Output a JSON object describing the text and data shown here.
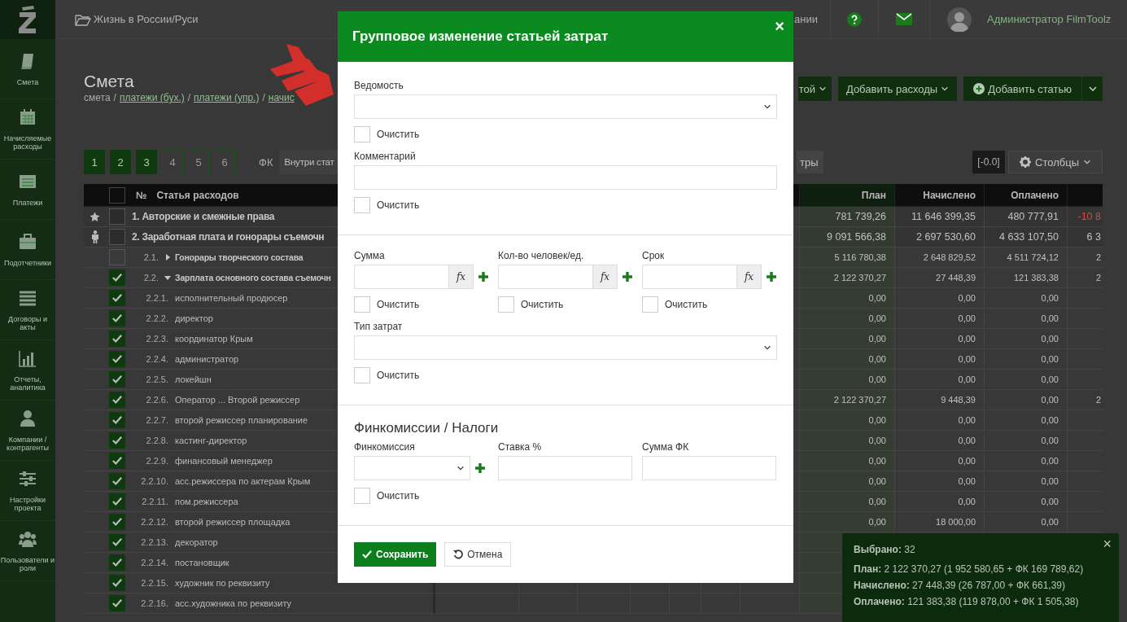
{
  "sidebar": {
    "items": [
      {
        "label": "Смета"
      },
      {
        "label": "Начисляемые расходы"
      },
      {
        "label": "Платежи"
      },
      {
        "label": "Подотчетники"
      },
      {
        "label": "Договоры и акты"
      },
      {
        "label": "Отчеты, аналитика"
      },
      {
        "label": "Компании / контрагенты"
      },
      {
        "label": "Настройки проекта"
      },
      {
        "label": "Пользователи и роли"
      }
    ]
  },
  "topbar": {
    "project": "Жизнь в России/Руси",
    "cut_link": "ании",
    "user": "Администратор FilmToolz"
  },
  "page": {
    "title": "Смета",
    "breadcrumbs": [
      {
        "label": "смета",
        "link": false
      },
      {
        "separator": "/",
        "label": "платежи (бух.)",
        "link": true
      },
      {
        "separator": "/",
        "label": "платежи (упр.)",
        "link": true
      },
      {
        "separator": "/",
        "label": "начис",
        "link": true
      }
    ],
    "actions": [
      {
        "label": "той",
        "kind": "dropdown"
      },
      {
        "label": "Добавить расходы",
        "kind": "dropdown"
      },
      {
        "label": "Добавить статью",
        "kind": "split"
      }
    ]
  },
  "levels": [
    {
      "label": "1",
      "selected": true
    },
    {
      "label": "2",
      "selected": true
    },
    {
      "label": "3",
      "selected": true
    },
    {
      "label": "4",
      "selected": false
    },
    {
      "label": "5",
      "selected": false
    },
    {
      "label": "6",
      "selected": false
    }
  ],
  "fk": {
    "label": "ФК",
    "value": "Внутри стат"
  },
  "filters_button": "тры",
  "rounding": "[-0.0]",
  "columns_button": "Столбцы",
  "table": {
    "header_checked": false,
    "columns": [
      "№",
      "Статья расходов",
      "План",
      "Начислено",
      "Оплачено"
    ],
    "rows": [
      {
        "kind": "group",
        "checked": false,
        "label": "1. Авторские и смежные права",
        "plan": "781 739,26",
        "accrued": "11 646 399,35",
        "paid": "480 777,91",
        "column_4": "-10 8",
        "negative": true
      },
      {
        "kind": "group",
        "checked": false,
        "label": "2. Заработная плата и гонорары съемочн",
        "plan": "9 091 566,38",
        "accrued": "2 697 530,60",
        "paid": "4 633 107,50",
        "column_4": "6 3",
        "negative": false
      },
      {
        "kind": "section",
        "checked": false,
        "expanded": false,
        "number": "2.1.",
        "title": "Гонорары творческого состава",
        "plan": "5 116 780,38",
        "accrued": "2 648 829,52",
        "paid": "4 511 724,12",
        "column_4": "2",
        "negative": false
      },
      {
        "kind": "section",
        "checked": true,
        "expanded": true,
        "number": "2.2.",
        "title": "Зарплата основного состава съемочн",
        "plan": "2 122 370,27",
        "accrued": "27 448,39",
        "paid": "121 383,38",
        "column_4": "2",
        "negative": false
      },
      {
        "kind": "item",
        "checked": true,
        "number": "2.2.1.",
        "title": "исполнительный продюсер",
        "plan": "0,00",
        "accrued": "0,00",
        "paid": "0,00"
      },
      {
        "kind": "item",
        "checked": true,
        "number": "2.2.2.",
        "title": "директор",
        "plan": "0,00",
        "accrued": "0,00",
        "paid": "0,00"
      },
      {
        "kind": "item",
        "checked": true,
        "number": "2.2.3.",
        "title": "координатор Крым",
        "plan": "0,00",
        "accrued": "0,00",
        "paid": "0,00"
      },
      {
        "kind": "item",
        "checked": true,
        "number": "2.2.4.",
        "title": "администратор",
        "plan": "0,00",
        "accrued": "0,00",
        "paid": "0,00"
      },
      {
        "kind": "item",
        "checked": true,
        "number": "2.2.5.",
        "title": "локейшн",
        "plan": "0,00",
        "accrued": "0,00",
        "paid": "0,00"
      },
      {
        "kind": "item",
        "checked": true,
        "number": "2.2.6.",
        "title": "Оператор ... Второй режиссер",
        "plan": "2 122 370,27",
        "accrued": "9 448,39",
        "paid": "0,00",
        "column_4": "2",
        "negative": false
      },
      {
        "kind": "item",
        "checked": true,
        "number": "2.2.7.",
        "title": "второй режиссер планирование",
        "plan": "0,00",
        "accrued": "0,00",
        "paid": "0,00"
      },
      {
        "kind": "item",
        "checked": true,
        "number": "2.2.8.",
        "title": "кастинг-директор",
        "plan": "0,00",
        "accrued": "0,00",
        "paid": "0,00"
      },
      {
        "kind": "item",
        "checked": true,
        "number": "2.2.9.",
        "title": "финансовый менеджер",
        "plan": "0,00",
        "accrued": "0,00",
        "paid": "0,00"
      },
      {
        "kind": "item",
        "checked": true,
        "number": "2.2.10.",
        "title": "асс.режиссера по актерам Крым",
        "plan": "0,00",
        "accrued": "0,00",
        "paid": "0,00"
      },
      {
        "kind": "item",
        "checked": true,
        "number": "2.2.11.",
        "title": "пом.режиссера",
        "plan": "0,00",
        "accrued": "0,00",
        "paid": "0,00"
      },
      {
        "kind": "item",
        "checked": true,
        "number": "2.2.12.",
        "title": "второй режиссер площадка",
        "plan": "0,00",
        "accrued": "18 000,00",
        "paid": "0,00"
      },
      {
        "kind": "item",
        "checked": true,
        "number": "2.2.13.",
        "title": "декоратор"
      },
      {
        "kind": "item",
        "checked": true,
        "number": "2.2.14.",
        "title": "постановщик"
      },
      {
        "kind": "item",
        "checked": true,
        "number": "2.2.15.",
        "title": "художник по реквизиту"
      },
      {
        "kind": "item",
        "checked": true,
        "number": "2.2.16.",
        "title": "асс.художника по реквизиту"
      }
    ]
  },
  "summary": {
    "close_label": "×",
    "lines": [
      "**Выбрано:** 32",
      "**План:** 2 122 370,27 (1 952 580,65 + ФК 169 789,62)",
      "**Начислено:** 27 448,39 (26 787,00 + ФК 661,39)",
      "**Оплачено:** 121 383,38 (119 878,00 + ФК 1 505,38)"
    ]
  },
  "modal": {
    "title": "Групповое изменение статьей затрат",
    "close_label": "×",
    "sections": [
      {
        "rows": [
          {
            "fields": [
              {
                "kind": "select",
                "label": "Ведомость",
                "clear": {
                  "label": "Очистить",
                  "checked": false
                }
              }
            ]
          },
          {
            "fields": [
              {
                "kind": "text",
                "label": "Комментарий",
                "clear": {
                  "label": "Очистить",
                  "checked": false
                }
              }
            ]
          }
        ]
      },
      {
        "rows": [
          {
            "fields": [
              {
                "kind": "formula",
                "label": "Сумма",
                "fx_label": "fx",
                "clear": {
                  "label": "Очистить",
                  "checked": false
                }
              },
              {
                "kind": "formula",
                "label": "Кол-во человек/ед.",
                "fx_label": "fx",
                "clear": {
                  "label": "Очистить",
                  "checked": false
                }
              },
              {
                "kind": "formula",
                "label": "Срок",
                "fx_label": "fx",
                "clear": {
                  "label": "Очистить",
                  "checked": false
                }
              }
            ]
          },
          {
            "fields": [
              {
                "kind": "select",
                "label": "Тип затрат",
                "clear": {
                  "label": "Очистить",
                  "checked": false
                }
              }
            ]
          }
        ]
      },
      {
        "heading": "Финкомиссии / Налоги",
        "rows": [
          {
            "fields": [
              {
                "kind": "select_plus",
                "label": "Финкомиссия",
                "clear": {
                  "label": "Очистить",
                  "checked": false
                }
              },
              {
                "kind": "text",
                "label": "Ставка %"
              },
              {
                "kind": "text",
                "label": "Сумма ФК"
              }
            ]
          }
        ]
      }
    ],
    "buttons": [
      {
        "label": "Сохранить",
        "kind": "primary"
      },
      {
        "label": "Отмена",
        "kind": "secondary"
      }
    ]
  }
}
